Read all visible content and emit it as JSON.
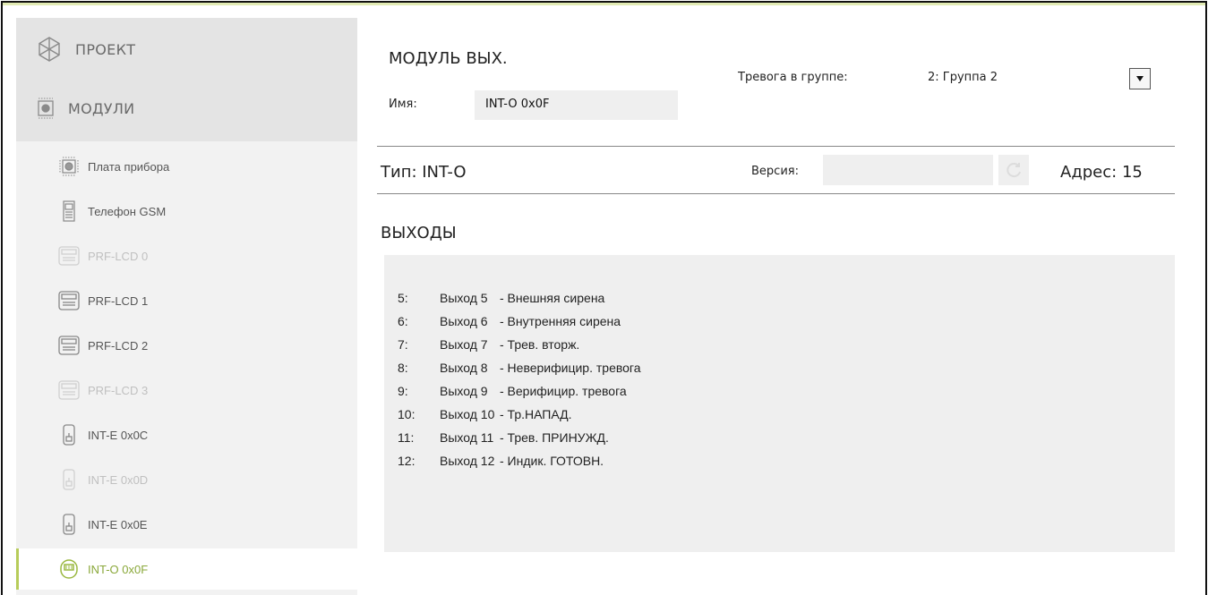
{
  "sidebar": {
    "project_label": "ПРОЕКТ",
    "modules_label": "МОДУЛИ",
    "items": [
      {
        "label": "Плата прибора",
        "icon": "mainboard-icon",
        "state": "normal"
      },
      {
        "label": "Телефон GSM",
        "icon": "phone-icon",
        "state": "normal"
      },
      {
        "label": "PRF-LCD 0",
        "icon": "keypad-icon",
        "state": "disabled"
      },
      {
        "label": "PRF-LCD 1",
        "icon": "keypad-icon",
        "state": "normal"
      },
      {
        "label": "PRF-LCD 2",
        "icon": "keypad-icon",
        "state": "normal"
      },
      {
        "label": "PRF-LCD 3",
        "icon": "keypad-icon",
        "state": "disabled"
      },
      {
        "label": "INT-E 0x0C",
        "icon": "expander-icon",
        "state": "normal"
      },
      {
        "label": "INT-E 0x0D",
        "icon": "expander-icon",
        "state": "disabled"
      },
      {
        "label": "INT-E 0x0E",
        "icon": "expander-icon",
        "state": "normal"
      },
      {
        "label": "INT-O 0x0F",
        "icon": "output-module-icon",
        "state": "selected"
      }
    ]
  },
  "module": {
    "title": "МОДУЛЬ ВЫХ.",
    "name_label": "Имя:",
    "name_value": "INT-O 0x0F",
    "alarm_group_label": "Тревога в группе:",
    "alarm_group_value": "2: Группа 2",
    "type_text": "Тип: INT-O",
    "version_label": "Версия:",
    "version_value": "",
    "address_text": "Адрес: 15"
  },
  "outputs": {
    "section_title": "ВЫХОДЫ",
    "rows": [
      {
        "num": "5:",
        "name": "Выход 5",
        "desc": "- Внешняя сирена"
      },
      {
        "num": "6:",
        "name": "Выход 6",
        "desc": "- Внутренняя сирена"
      },
      {
        "num": "7:",
        "name": "Выход 7",
        "desc": "- Трев. вторж."
      },
      {
        "num": "8:",
        "name": "Выход 8",
        "desc": "- Неверифицир. тревога"
      },
      {
        "num": "9:",
        "name": "Выход 9",
        "desc": "- Верифицир. тревога"
      },
      {
        "num": "10:",
        "name": "Выход 10",
        "desc": "- Тр.НАПАД."
      },
      {
        "num": "11:",
        "name": "Выход 11",
        "desc": "- Трев. ПРИНУЖД."
      },
      {
        "num": "12:",
        "name": "Выход 12",
        "desc": "- Индик. ГОТОВН."
      }
    ]
  },
  "colors": {
    "accent": "#b7cc5a",
    "selected_text": "#8aa83a",
    "disabled_text": "#c0c0c0",
    "panel_gray": "#efefef"
  }
}
